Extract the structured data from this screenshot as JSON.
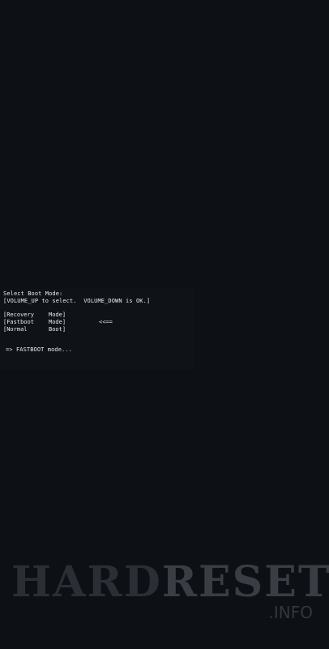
{
  "boot_menu": {
    "title": "Select Boot Mode:",
    "instructions": "[VOLUME_UP to select.  VOLUME_DOWN is OK.]",
    "options": [
      {
        "left": "[Recovery",
        "right": "Mode]"
      },
      {
        "left": "[Fastboot",
        "right": "Mode]"
      },
      {
        "left": "[Normal",
        "right": "Boot]"
      }
    ],
    "selection_indicator": "<<==",
    "status": "=> FASTBOOT mode..."
  },
  "watermark": {
    "brand_hard": "HARD",
    "brand_reset": "RESET",
    "suffix": ".INFO"
  },
  "colors": {
    "background": "#0d1015",
    "text": "#e6ecf5"
  }
}
